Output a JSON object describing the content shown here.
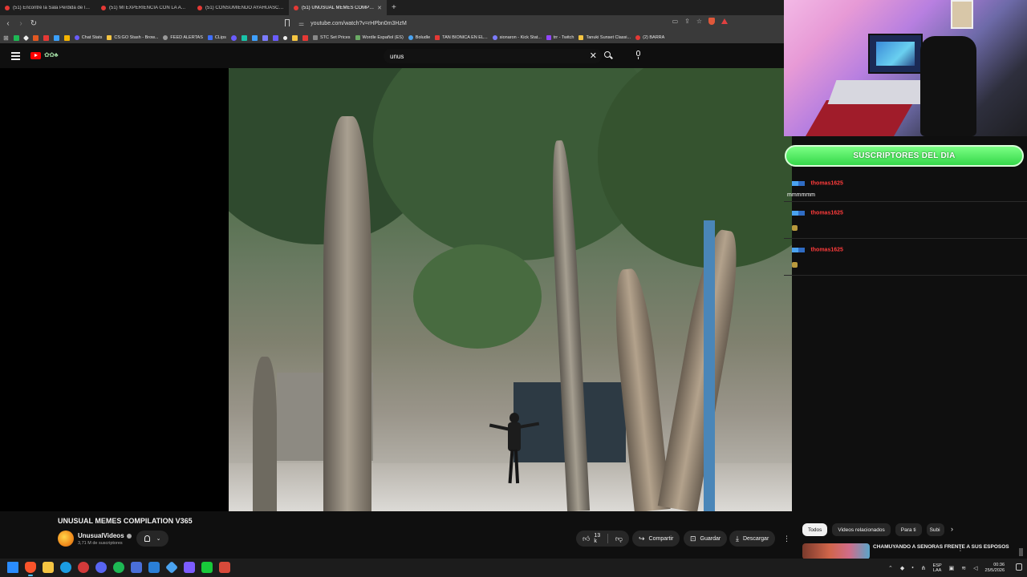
{
  "browser": {
    "tabs": [
      {
        "label": "(51) Encontré la Sala Perdida de las C...",
        "active": false
      },
      {
        "label": "(51) MI EXPERIENCIA CON LA AYAHU...",
        "active": false
      },
      {
        "label": "(51) CONSUMIENDO AYAHUASCA EN...",
        "active": false
      },
      {
        "label": "(51) UNUSUAL MEMES COMPI...",
        "active": true
      }
    ],
    "new_tab": "+",
    "url": "youtube.com/watch?v=rHPbn0m3HzM",
    "bookmarks": [
      {
        "label": "Chat Stats",
        "color": "#6a5cff"
      },
      {
        "label": "CS:GO Stash - Brow...",
        "color": "#f5c542"
      },
      {
        "label": "FEED ALERTAS",
        "color": "#9a9a9a"
      },
      {
        "label": "CLips",
        "color": "#3f6fff"
      },
      {
        "label": "STC Set Prices",
        "color": "#888888"
      },
      {
        "label": "Wordle Español (ES)",
        "color": "#6aaa64"
      },
      {
        "label": "Boludle",
        "color": "#4aa3f0"
      },
      {
        "label": "TAN BIONICA EN EL...",
        "color": "#e53935"
      },
      {
        "label": "sionaron - Kick Stat...",
        "color": "#7c7cff"
      },
      {
        "label": "trr - Twitch",
        "color": "#9146ff"
      },
      {
        "label": "Tanuki Sunset Classi...",
        "color": "#f5c542"
      },
      {
        "label": "(2) BARRA",
        "color": "#e53935"
      }
    ]
  },
  "youtube": {
    "search_value": "unus",
    "video": {
      "title": "UNUSUAL MEMES COMPILATION V365",
      "channel": "UnusualVideos",
      "subscribers": "3,71 M de suscriptores",
      "likes": "13 k",
      "share_label": "Compartir",
      "save_label": "Guardar",
      "download_label": "Descargar",
      "more_label": "⋮"
    },
    "chips": [
      "Todos",
      "Videos relacionados",
      "Para ti",
      "Subi"
    ],
    "recommended": {
      "title": "CHAMUYANDO A SEÑORAS FRENTE A SUS ESPOSOS",
      "more": "⋮"
    }
  },
  "stream_overlay": {
    "banner_text": "SUSCRIPTORES DEL DIA",
    "chat": [
      {
        "user": "thomas1625",
        "text": "mmmmmm"
      },
      {
        "user": "thomas1625",
        "text": ""
      },
      {
        "user": "thomas1625",
        "text": ""
      }
    ]
  },
  "taskbar": {
    "lang_line1": "ESP",
    "lang_line2": "LAA",
    "time": "00:36",
    "date": "25/5/2026"
  }
}
